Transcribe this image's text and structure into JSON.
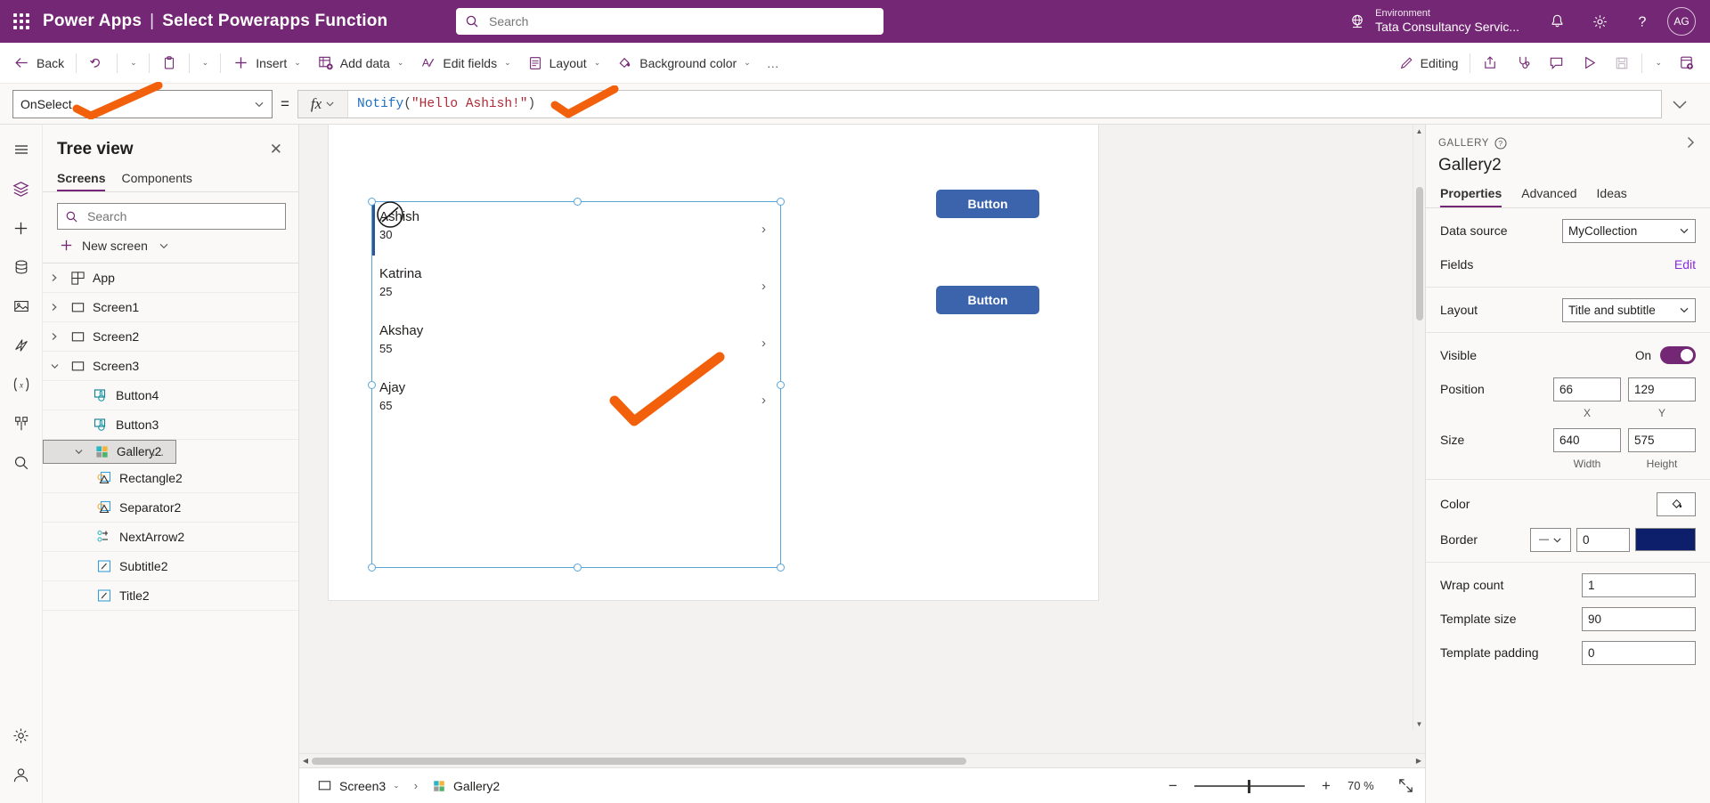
{
  "topbar": {
    "brand": "Power Apps",
    "separator": "|",
    "app_title": "Select Powerapps Function",
    "search_placeholder": "Search",
    "search_value": "",
    "environment_label": "Environment",
    "environment_value": "Tata Consultancy Servic...",
    "avatar_initials": "AG",
    "icons": {
      "waffle": "app-launcher-icon",
      "search": "search-icon",
      "globe": "environment-globe-icon",
      "bell": "notifications-icon",
      "gear": "settings-icon",
      "help": "help-icon"
    }
  },
  "commandbar": {
    "back": "Back",
    "undo": "undo-icon",
    "undo_chevron": "⌄",
    "paste": "paste-icon",
    "paste_chevron": "⌄",
    "insert": "Insert",
    "add_data": "Add data",
    "edit_fields": "Edit fields",
    "layout": "Layout",
    "background_color": "Background color",
    "overflow": "…",
    "editing": "Editing",
    "right_icons": [
      "share-icon",
      "app-checker-icon",
      "comments-icon",
      "play-preview-icon",
      "save-icon",
      "chevron-down-icon",
      "publish-icon"
    ]
  },
  "formulabar": {
    "property": "OnSelect",
    "equals": "=",
    "fx_label": "fx",
    "formula_parts": [
      {
        "text": "Notify",
        "kind": "fn"
      },
      {
        "text": "(",
        "kind": "par"
      },
      {
        "text": "\"Hello Ashish!\"",
        "kind": "str"
      },
      {
        "text": ")",
        "kind": "par"
      }
    ],
    "formula_full": "Notify(\"Hello Ashish!\")"
  },
  "rail": {
    "items": [
      "hamburger-menu-icon",
      "tree-view-icon",
      "insert-icon",
      "data-icon",
      "media-icon",
      "power-automate-icon",
      "variables-icon",
      "components-icon",
      "search-icon",
      "settings-icon",
      "account-icon"
    ]
  },
  "treeview": {
    "title": "Tree view",
    "close": "✕",
    "tabs": [
      {
        "label": "Screens",
        "active": true
      },
      {
        "label": "Components",
        "active": false
      }
    ],
    "search_placeholder": "Search",
    "search_value": "",
    "new_screen": "New screen",
    "items": [
      {
        "label": "App",
        "icon": "app-icon",
        "caret": "collapsed",
        "indent": 0,
        "selected": false
      },
      {
        "label": "Screen1",
        "icon": "screen-icon",
        "caret": "collapsed",
        "indent": 0,
        "selected": false
      },
      {
        "label": "Screen2",
        "icon": "screen-icon",
        "caret": "collapsed",
        "indent": 0,
        "selected": false
      },
      {
        "label": "Screen3",
        "icon": "screen-icon",
        "caret": "expanded",
        "indent": 0,
        "selected": false
      },
      {
        "label": "Button4",
        "icon": "button-icon",
        "caret": "none",
        "indent": 1,
        "selected": false
      },
      {
        "label": "Button3",
        "icon": "button-icon",
        "caret": "none",
        "indent": 1,
        "selected": false
      },
      {
        "label": "Gallery2",
        "icon": "gallery-icon",
        "caret": "expanded",
        "indent": 1,
        "selected": true,
        "more": "..."
      },
      {
        "label": "Rectangle2",
        "icon": "shape-icon",
        "caret": "none",
        "indent": 2,
        "selected": false
      },
      {
        "label": "Separator2",
        "icon": "shape-icon",
        "caret": "none",
        "indent": 2,
        "selected": false
      },
      {
        "label": "NextArrow2",
        "icon": "nextarrow-icon",
        "caret": "none",
        "indent": 2,
        "selected": false
      },
      {
        "label": "Subtitle2",
        "icon": "label-icon",
        "caret": "none",
        "indent": 2,
        "selected": false
      },
      {
        "label": "Title2",
        "icon": "label-icon",
        "caret": "none",
        "indent": 2,
        "selected": false
      }
    ]
  },
  "canvas": {
    "gallery_items": [
      {
        "title": "Ashish",
        "subtitle": "30"
      },
      {
        "title": "Katrina",
        "subtitle": "25"
      },
      {
        "title": "Akshay",
        "subtitle": "55"
      },
      {
        "title": "Ajay",
        "subtitle": "65"
      }
    ],
    "buttons": [
      {
        "label": "Button"
      },
      {
        "label": "Button"
      }
    ],
    "arrow_glyph": "›"
  },
  "statusbar": {
    "screen": "Screen3",
    "control": "Gallery2",
    "separator": "›",
    "zoom_out": "−",
    "zoom_in": "+",
    "zoom_value": "70",
    "zoom_unit": "%",
    "fit_icon": "fit-to-screen-icon"
  },
  "properties": {
    "kind": "GALLERY",
    "help_icon": "help-circle-icon",
    "collapse_icon": "chevron-right-icon",
    "name": "Gallery2",
    "tabs": [
      {
        "label": "Properties",
        "active": true
      },
      {
        "label": "Advanced",
        "active": false
      },
      {
        "label": "Ideas",
        "active": false
      }
    ],
    "data_source": {
      "label": "Data source",
      "value": "MyCollection"
    },
    "fields": {
      "label": "Fields",
      "action": "Edit"
    },
    "layout": {
      "label": "Layout",
      "value": "Title and subtitle"
    },
    "visible": {
      "label": "Visible",
      "state": "On"
    },
    "position": {
      "label": "Position",
      "x": "66",
      "y": "129",
      "x_label": "X",
      "y_label": "Y"
    },
    "size": {
      "label": "Size",
      "width": "640",
      "height": "575",
      "width_label": "Width",
      "height_label": "Height"
    },
    "color": {
      "label": "Color",
      "icon": "fill-color-icon"
    },
    "border": {
      "label": "Border",
      "style": "—",
      "thickness": "0",
      "swatch": "#0d1f6b"
    },
    "wrap_count": {
      "label": "Wrap count",
      "value": "1"
    },
    "template_size": {
      "label": "Template size",
      "value": "90"
    },
    "template_padding": {
      "label": "Template padding",
      "value": "0"
    }
  },
  "colors": {
    "brand_purple": "#742774",
    "accent_button_blue": "#3c64ad",
    "selection_blue": "#5aa5d8",
    "annotation_orange": "#f2600c"
  }
}
